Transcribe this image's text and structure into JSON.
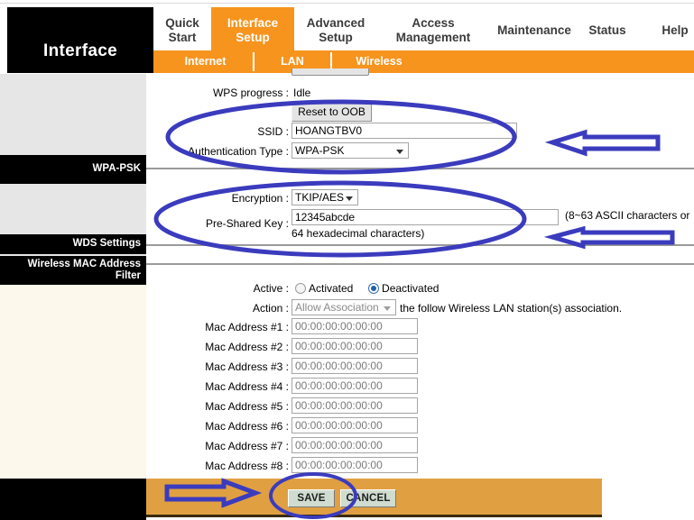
{
  "header": {
    "brand_title": "Interface",
    "nav": [
      {
        "line1": "Quick",
        "line2": "Start"
      },
      {
        "line1": "Interface",
        "line2": "Setup"
      },
      {
        "line1": "Advanced",
        "line2": "Setup"
      },
      {
        "line1": "Access",
        "line2": "Management"
      },
      {
        "line1": "Maintenance",
        "line2": ""
      },
      {
        "line1": "Status",
        "line2": ""
      },
      {
        "line1": "Help",
        "line2": ""
      }
    ],
    "subnav": [
      "Internet",
      "LAN",
      "Wireless"
    ]
  },
  "sidebar": {
    "wpa_psk_label": "WPA-PSK",
    "wds_label": "WDS Settings",
    "mac_filter_line1": "Wireless MAC Address",
    "mac_filter_line2": "Filter"
  },
  "wps": {
    "progress_label": "WPS progress :",
    "progress_value": "Idle",
    "reset_button": "Reset to OOB"
  },
  "wpa": {
    "ssid_label": "SSID :",
    "ssid_value": "HOANGTBV0",
    "auth_label": "Authentication Type :",
    "auth_value": "WPA-PSK",
    "encryption_label": "Encryption :",
    "encryption_value": "TKIP/AES",
    "psk_label": "Pre-Shared Key :",
    "psk_value": "12345abcde",
    "psk_hint_right": "(8~63 ASCII characters or",
    "psk_hint_below": "64 hexadecimal characters)"
  },
  "mac_filter": {
    "active_label": "Active :",
    "active_option_on": "Activated",
    "active_option_off": "Deactivated",
    "active_selected": "Deactivated",
    "action_label": "Action :",
    "action_value": "Allow Association",
    "action_suffix": "the follow Wireless LAN station(s) association.",
    "rows": [
      {
        "label": "Mac Address #1 :",
        "value": "00:00:00:00:00:00"
      },
      {
        "label": "Mac Address #2 :",
        "value": "00:00:00:00:00:00"
      },
      {
        "label": "Mac Address #3 :",
        "value": "00:00:00:00:00:00"
      },
      {
        "label": "Mac Address #4 :",
        "value": "00:00:00:00:00:00"
      },
      {
        "label": "Mac Address #5 :",
        "value": "00:00:00:00:00:00"
      },
      {
        "label": "Mac Address #6 :",
        "value": "00:00:00:00:00:00"
      },
      {
        "label": "Mac Address #7 :",
        "value": "00:00:00:00:00:00"
      },
      {
        "label": "Mac Address #8 :",
        "value": "00:00:00:00:00:00"
      }
    ]
  },
  "footer": {
    "save_label": "SAVE",
    "cancel_label": "CANCEL"
  },
  "colors": {
    "accent_orange": "#f7941e",
    "footer_orange": "#e0a041",
    "annotation_blue": "#3b3bbe",
    "sidebar_grey": "#e6e6e6",
    "sidebar_cream": "#fdf8ec"
  }
}
